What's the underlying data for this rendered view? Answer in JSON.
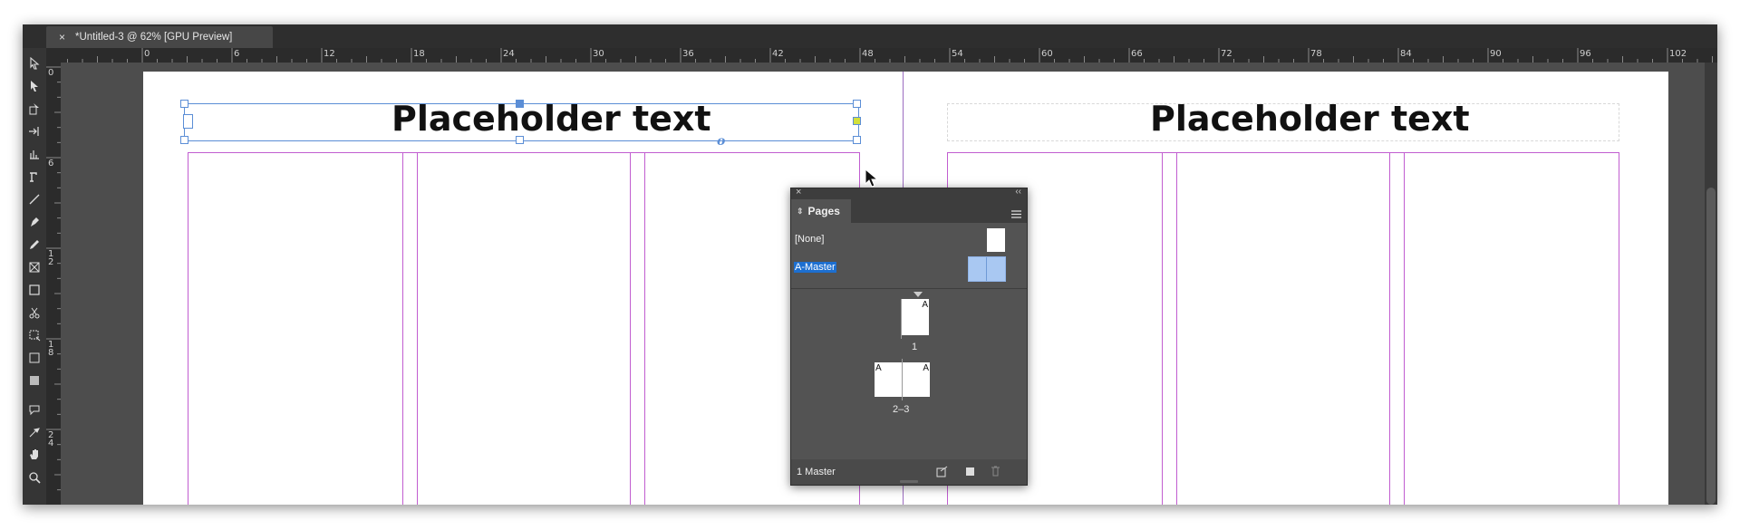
{
  "document_tab": {
    "close_glyph": "×",
    "title": "*Untitled-3 @ 62% [GPU Preview]"
  },
  "ruler": {
    "horizontal_labels": [
      "0",
      "6",
      "12",
      "18",
      "24",
      "30",
      "36",
      "42",
      "48",
      "54",
      "60",
      "66",
      "72",
      "78",
      "84",
      "90",
      "96",
      "102"
    ],
    "vertical_labels": [
      "0",
      "6",
      "12",
      "18",
      "24"
    ]
  },
  "canvas": {
    "left_page_text": "Placeholder text",
    "right_page_text": "Placeholder text"
  },
  "pages_panel": {
    "close_glyph": "×",
    "collapse_glyph": "‹‹",
    "tab_label": "Pages",
    "menu_icon": "hamburger-menu-icon",
    "masters": [
      {
        "name": "[None]",
        "selected": false
      },
      {
        "name": "A-Master",
        "selected": true
      }
    ],
    "pages": [
      {
        "label": "1",
        "prefix": "A"
      },
      {
        "label": "2–3",
        "prefix_left": "A",
        "prefix_right": "A"
      }
    ],
    "footer": {
      "status": "1 Master",
      "icons": [
        "edit-page-size-icon",
        "new-page-icon",
        "delete-page-icon"
      ]
    }
  },
  "tools": [
    "selection-tool-icon",
    "direct-selection-tool-icon",
    "page-tool-icon",
    "gap-tool-icon",
    "content-collector-icon",
    "type-tool-icon",
    "line-tool-icon",
    "pen-tool-icon",
    "pencil-tool-icon",
    "rectangle-frame-tool-icon",
    "rectangle-tool-icon",
    "scissors-tool-icon",
    "free-transform-tool-icon",
    "gradient-swatch-tool-icon",
    "gradient-feather-tool-icon",
    "note-tool-icon",
    "eyedropper-tool-icon",
    "hand-tool-icon",
    "zoom-tool-icon"
  ],
  "colors": {
    "selection": "#5b8ed6",
    "column_guide": "#c15dd0",
    "panel_highlight": "#1d6fd0"
  }
}
